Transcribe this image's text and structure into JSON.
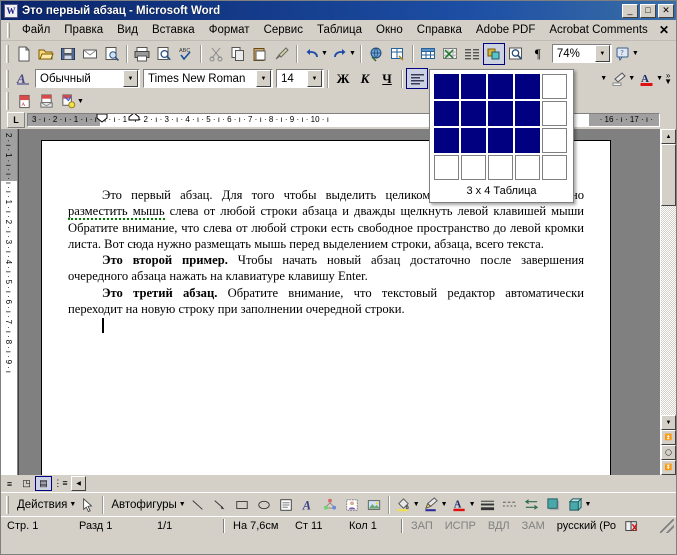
{
  "window": {
    "title": "Это первый абзац - Microsoft Word",
    "app_icon": "word-document-icon",
    "minimize": "_",
    "maximize": "□",
    "close": "✕"
  },
  "menubar": {
    "items": [
      {
        "label": "Файл"
      },
      {
        "label": "Правка"
      },
      {
        "label": "Вид"
      },
      {
        "label": "Вставка"
      },
      {
        "label": "Формат"
      },
      {
        "label": "Сервис"
      },
      {
        "label": "Таблица"
      },
      {
        "label": "Окно"
      },
      {
        "label": "Справка"
      },
      {
        "label": "Adobe PDF"
      },
      {
        "label": "Acrobat Comments"
      }
    ],
    "close_doc": "✕"
  },
  "standard_toolbar": {
    "buttons": [
      {
        "name": "new-document-icon",
        "glyph": "🗋"
      },
      {
        "name": "open-folder-icon",
        "glyph": "📂"
      },
      {
        "name": "save-icon",
        "glyph": "💾"
      },
      {
        "name": "email-icon",
        "glyph": "✉"
      },
      {
        "name": "search-document-icon",
        "glyph": "🔍"
      },
      {
        "name": "print-icon",
        "glyph": "🖶"
      },
      {
        "name": "print-preview-icon",
        "glyph": "🔎"
      },
      {
        "name": "spelling-check-icon",
        "glyph": "ABC"
      },
      {
        "name": "cut-scissors-icon",
        "glyph": "✂"
      },
      {
        "name": "copy-icon",
        "glyph": "⎘"
      },
      {
        "name": "paste-icon",
        "glyph": "📋"
      },
      {
        "name": "format-painter-icon",
        "glyph": "🖌"
      },
      {
        "name": "undo-icon",
        "glyph": "↰"
      },
      {
        "name": "redo-icon",
        "glyph": "↱"
      },
      {
        "name": "hyperlink-globe-icon",
        "glyph": "🌐"
      },
      {
        "name": "tables-borders-icon",
        "glyph": "▦"
      },
      {
        "name": "insert-table-icon",
        "glyph": "▤"
      },
      {
        "name": "insert-excel-sheet-icon",
        "glyph": "▨"
      },
      {
        "name": "columns-icon",
        "glyph": "≣"
      },
      {
        "name": "drawing-icon",
        "glyph": "◪"
      },
      {
        "name": "document-map-icon",
        "glyph": "🔍"
      },
      {
        "name": "show-formatting-marks-icon",
        "glyph": "¶"
      }
    ],
    "zoom_value": "74%",
    "help_icon": "help-question-icon"
  },
  "formatting_toolbar": {
    "styles_icon": "style-letter-icon",
    "style_value": "Обычный",
    "font_value": "Times New Roman",
    "size_value": "14",
    "bold_label": "Ж",
    "italic_label": "К",
    "underline_label": "Ч",
    "align_left_icon": "align-left-icon",
    "align_center_icon": "align-center-icon",
    "highlight_icon": "highlight-pen-icon",
    "font_color_icon": "font-color-a-icon",
    "overflow_label": "»"
  },
  "pdf_toolbar": {
    "buttons": [
      {
        "name": "convert-to-pdf-icon"
      },
      {
        "name": "convert-and-email-pdf-icon"
      },
      {
        "name": "convert-and-review-pdf-icon"
      }
    ]
  },
  "ruler": {
    "tab_stop_label": "L",
    "horizontal_ticks": "3 · ı · 2 · ı · 1 · ı · ı · ı · ı · 1 · ı · 2 · ı · 3 · ı · 4 · ı · 5 · ı · 6 · ı · 7 · ı · 8 · ı · 9 · ı · 10 · ı",
    "horizontal_right_ticks": "· 16 · ı · 17 · ı ·",
    "vertical_ticks": [
      "2",
      "1",
      "1",
      "2",
      "3",
      "4",
      "5",
      "6",
      "7",
      "8",
      "9"
    ]
  },
  "table_grid_popup": {
    "rows": 4,
    "cols": 5,
    "selected_rows": 3,
    "selected_cols": 4,
    "caption": "3 x 4 Таблица",
    "selected_color": "#000080"
  },
  "document": {
    "paragraphs": [
      {
        "id": "p1",
        "runs": [
          {
            "text": "Это первый абзац. Для того чтобы выделить целиком весь пример, достаточно ",
            "style": "normal"
          },
          {
            "text": "разместить мышь",
            "style": "misspell"
          },
          {
            "text": " слева от любой строки абзаца и дважды щелкнуть левой клавишей мыши  Обратите внимание, что слева от любой строки есть свободное пространство до левой кромки листа. Вот сюда нужно размещать мышь перед выделением строки, абзаца, всего текста.",
            "style": "normal"
          }
        ]
      },
      {
        "id": "p2",
        "runs": [
          {
            "text": "Это второй пример.",
            "style": "bold"
          },
          {
            "text": " Чтобы начать новый абзац достаточно после завершения очередного абзаца нажать на клавиатуре клавишу Enter.",
            "style": "normal"
          }
        ]
      },
      {
        "id": "p3",
        "runs": [
          {
            "text": "Это третий абзац.",
            "style": "bold"
          },
          {
            "text": " Обратите внимание, что текстовый редактор автоматически переходит на новую строку при заполнении очередной строки.",
            "style": "normal"
          }
        ]
      }
    ]
  },
  "view_bar": {
    "buttons": [
      {
        "name": "normal-view-icon",
        "glyph": "≡",
        "selected": false
      },
      {
        "name": "web-layout-view-icon",
        "glyph": "◳",
        "selected": false
      },
      {
        "name": "print-layout-view-icon",
        "glyph": "▤",
        "selected": true
      },
      {
        "name": "outline-view-icon",
        "glyph": "⋮≡",
        "selected": false
      }
    ]
  },
  "drawing_toolbar": {
    "actions_label": "Действия",
    "select_arrow_icon": "select-arrow-icon",
    "autoshapes_label": "Автофигуры",
    "buttons": [
      {
        "name": "line-icon",
        "glyph": "╲"
      },
      {
        "name": "arrow-icon",
        "glyph": "↘"
      },
      {
        "name": "rectangle-icon",
        "glyph": "▭"
      },
      {
        "name": "oval-icon",
        "glyph": "◯"
      },
      {
        "name": "text-box-icon",
        "glyph": "▤"
      },
      {
        "name": "wordart-icon",
        "glyph": "4"
      },
      {
        "name": "diagram-icon",
        "glyph": "❂"
      },
      {
        "name": "clipart-icon",
        "glyph": "🖼"
      },
      {
        "name": "picture-icon",
        "glyph": "🏞"
      },
      {
        "name": "fill-color-icon",
        "glyph": "🪣"
      },
      {
        "name": "line-color-icon",
        "glyph": "🖉"
      },
      {
        "name": "font-color-icon",
        "glyph": "A"
      },
      {
        "name": "line-style-icon",
        "glyph": "≡"
      },
      {
        "name": "dash-style-icon",
        "glyph": "┄"
      },
      {
        "name": "arrow-style-icon",
        "glyph": "⇄"
      },
      {
        "name": "shadow-style-icon",
        "glyph": "▣"
      },
      {
        "name": "3d-style-icon",
        "glyph": "▢"
      }
    ]
  },
  "status_bar": {
    "page_label": "Стр. 1",
    "section_label": "Разд 1",
    "pages_label": "1/1",
    "position_label": "На 7,6см",
    "line_label": "Ст 11",
    "column_label": "Кол 1",
    "rec_label": "ЗАП",
    "trk_label": "ИСПР",
    "ext_label": "ВДЛ",
    "ovr_label": "ЗАМ",
    "language_label": "русский (Ро",
    "spellcheck_icon": "spellcheck-book-icon"
  },
  "colors": {
    "titlebar_start": "#0a246a",
    "titlebar_end": "#3a6ea5",
    "face": "#d4d0c8",
    "grid_selected": "#000080",
    "page_bg": "#808080",
    "misspell_underline": "#008000"
  }
}
